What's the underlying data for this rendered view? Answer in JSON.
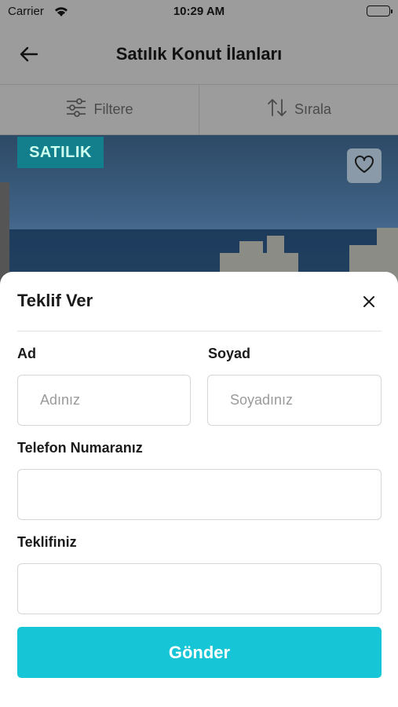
{
  "status_bar": {
    "carrier": "Carrier",
    "time": "10:29 AM"
  },
  "nav": {
    "title": "Satılık Konut İlanları",
    "back_icon": "arrow-left-icon"
  },
  "toolbar": {
    "filter_label": "Filtere",
    "sort_label": "Sırala",
    "filter_icon": "sliders-icon",
    "sort_icon": "sort-arrows-icon"
  },
  "listing": {
    "badge": "SATILIK",
    "favorite_icon": "heart-icon",
    "badge_color": "#1ba6b8"
  },
  "offer_sheet": {
    "title": "Teklif Ver",
    "close_icon": "close-icon",
    "first_name": {
      "label": "Ad",
      "placeholder": "Adınız",
      "value": ""
    },
    "last_name": {
      "label": "Soyad",
      "placeholder": "Soyadınız",
      "value": ""
    },
    "phone": {
      "label": "Telefon Numaranız",
      "placeholder": "",
      "value": ""
    },
    "offer": {
      "label": "Teklifiniz",
      "placeholder": "",
      "value": ""
    },
    "submit_label": "Gönder",
    "accent_color": "#16c6d6"
  }
}
